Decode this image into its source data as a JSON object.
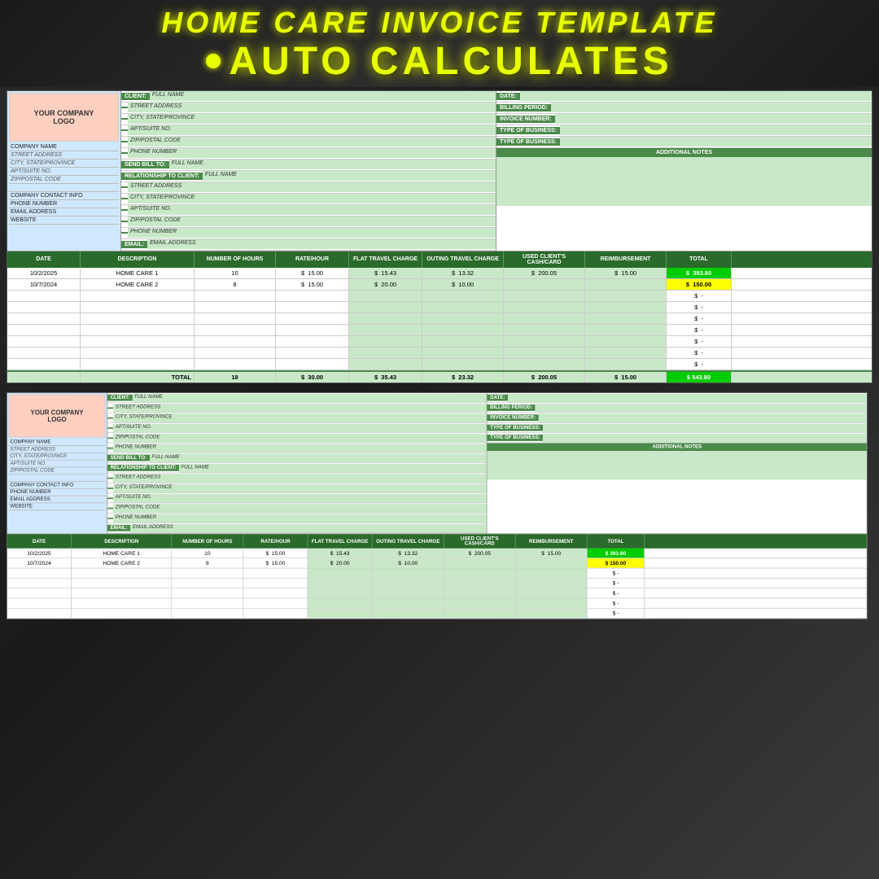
{
  "header": {
    "title": "HOME CARE INVOICE TEMPLATE",
    "subtitle": "AUTO CALCULATES"
  },
  "invoice1": {
    "company": {
      "logo": "YOUR COMPANY\nLOGO",
      "fields": [
        {
          "label": "COMPANY NAME",
          "italic": false
        },
        {
          "label": "STREET ADDRESS",
          "italic": true
        },
        {
          "label": "CITY, STATE/PROVINCE",
          "italic": true
        },
        {
          "label": "APT/SUITE NO.",
          "italic": true
        },
        {
          "label": "ZIP/POSTAL CODE",
          "italic": true
        },
        {
          "label": "COMPANY CONTACT INFO",
          "italic": false
        },
        {
          "label": "PHONE NUMBER",
          "italic": false
        },
        {
          "label": "EMAIL ADDRESS",
          "italic": false
        },
        {
          "label": "WEBSITE",
          "italic": false
        }
      ]
    },
    "client": {
      "rows": [
        {
          "label": "CLIENT:",
          "value": "FULL NAME"
        },
        {
          "label": "",
          "value": "STREET ADDRESS"
        },
        {
          "label": "",
          "value": "CITY, STATE/PROVINCE"
        },
        {
          "label": "",
          "value": "APT/SUITE NO."
        },
        {
          "label": "",
          "value": "ZIP/POSTAL CODE"
        },
        {
          "label": "",
          "value": "PHONE NUMBER"
        },
        {
          "label": "SEND BILL TO:",
          "value": "FULL NAME"
        },
        {
          "label": "RELATIONSHIP TO CLIENT:",
          "value": "FULL NAME"
        },
        {
          "label": "",
          "value": "STREET ADDRESS"
        },
        {
          "label": "",
          "value": "CITY, STATE/PROVINCE"
        },
        {
          "label": "",
          "value": "APT/SUITE NO."
        },
        {
          "label": "",
          "value": "ZIP/POSTAL CODE"
        },
        {
          "label": "",
          "value": "PHONE NUMBER"
        },
        {
          "label": "EMAIL:",
          "value": "EMAIL ADDRESS"
        }
      ]
    },
    "right": {
      "rows": [
        {
          "label": "DATE:",
          "value": ""
        },
        {
          "label": "BILLING PERIOD:",
          "value": ""
        },
        {
          "label": "INVOICE NUMBER:",
          "value": ""
        },
        {
          "label": "TYPE OF BUSINESS:",
          "value": ""
        },
        {
          "label": "TYPE OF BUSINESS:",
          "value": ""
        }
      ],
      "additional_notes": "ADDITIONAL NOTES"
    },
    "table": {
      "headers": [
        "DATE",
        "DESCRIPTION",
        "NUMBER OF HOURS",
        "RATE/HOUR",
        "FLAT TRAVEL CHARGE",
        "OUTING TRAVEL CHARGE",
        "USED CLIENT'S CASH/CARD",
        "REIMBURSEMENT",
        "TOTAL"
      ],
      "rows": [
        {
          "date": "10/2/2025",
          "desc": "HOME CARE 1",
          "hours": "10",
          "rate": "$ 15.00",
          "flat": "$ 15.43",
          "outing": "$ 13.32",
          "used": "$ 200.05",
          "reimb": "$ 15.00",
          "total": "393.80",
          "total_green": true
        },
        {
          "date": "10/7/2024",
          "desc": "HOME CARE 2",
          "hours": "8",
          "rate": "$ 15.00",
          "flat": "$ 20.00",
          "outing": "$ 10.00",
          "used": "",
          "reimb": "",
          "total": "150.00",
          "total_yellow": true
        },
        {
          "date": "",
          "desc": "",
          "hours": "",
          "rate": "",
          "flat": "",
          "outing": "",
          "used": "",
          "reimb": "",
          "total": "-"
        },
        {
          "date": "",
          "desc": "",
          "hours": "",
          "rate": "",
          "flat": "",
          "outing": "",
          "used": "",
          "reimb": "",
          "total": "-"
        },
        {
          "date": "",
          "desc": "",
          "hours": "",
          "rate": "",
          "flat": "",
          "outing": "",
          "used": "",
          "reimb": "",
          "total": "-"
        },
        {
          "date": "",
          "desc": "",
          "hours": "",
          "rate": "",
          "flat": "",
          "outing": "",
          "used": "",
          "reimb": "",
          "total": "-"
        },
        {
          "date": "",
          "desc": "",
          "hours": "",
          "rate": "",
          "flat": "",
          "outing": "",
          "used": "",
          "reimb": "",
          "total": "-"
        },
        {
          "date": "",
          "desc": "",
          "hours": "",
          "rate": "",
          "flat": "",
          "outing": "",
          "used": "",
          "reimb": "",
          "total": "-"
        },
        {
          "date": "",
          "desc": "",
          "hours": "",
          "rate": "",
          "flat": "",
          "outing": "",
          "used": "",
          "reimb": "",
          "total": "-"
        }
      ],
      "total_row": {
        "label": "TOTAL",
        "hours": "18",
        "rate": "$ 30.00",
        "flat": "$ 35.43",
        "outing": "$ 23.32",
        "used": "$ 200.05",
        "reimb": "$ 15.00",
        "total": "543.80"
      }
    }
  }
}
